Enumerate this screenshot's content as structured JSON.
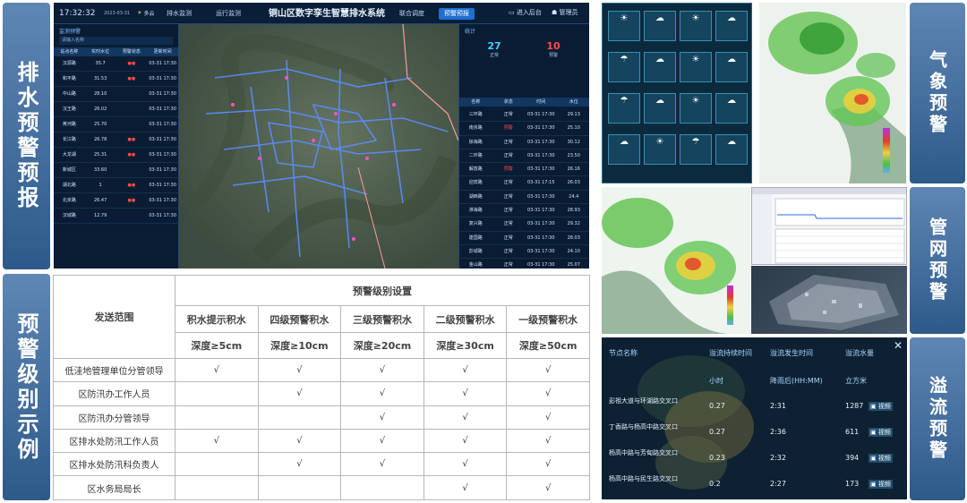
{
  "labels": {
    "drainage_warning": "排水预警预报",
    "level_examples": "预警级别示例",
    "weather_warning": "气象预警",
    "pipe_warning": "管网预警",
    "overflow_warning": "溢流预警"
  },
  "dashboard": {
    "clock": "17:32:32",
    "date": "2023-03-31",
    "weather": "多云",
    "title": "铜山区数字孪生智慧排水系统",
    "tabs": [
      "排水监测",
      "运行监测",
      "联合调度",
      "预警预报"
    ],
    "active_tab": 3,
    "enter_label": "进入后台",
    "user_label": "管理员",
    "left_panel_title": "监测预警",
    "search_placeholder": "请输入名称",
    "left_columns": [
      "站点名称",
      "实时水位",
      "预警状态",
      "更新时间"
    ],
    "left_rows": [
      [
        "汉源路",
        "35.7",
        "●●",
        "03-31 17:30"
      ],
      [
        "和平路",
        "31.53",
        "●●",
        "03-31 17:30"
      ],
      [
        "中山路",
        "28.10",
        "",
        "03-31 17:30"
      ],
      [
        "汉王路",
        "26.02",
        "",
        "03-31 17:30"
      ],
      [
        "黄河路",
        "25.70",
        "",
        "03-31 17:30"
      ],
      [
        "长江路",
        "26.78",
        "●●",
        "03-31 17:30"
      ],
      [
        "大龙湖",
        "25.31",
        "●●",
        "03-31 17:30"
      ],
      [
        "新城区",
        "33.60",
        "",
        "03-31 17:30"
      ],
      [
        "湖北路",
        "1",
        "●●",
        "03-31 17:30"
      ],
      [
        "北京路",
        "26.47",
        "●●",
        "03-31 17:30"
      ],
      [
        "汉城路",
        "12.79",
        "",
        "03-31 17:30"
      ]
    ],
    "right_panel_title": "统计",
    "count_a": "27",
    "count_a_label": "正常",
    "count_b": "10",
    "count_b_label": "预警",
    "right_columns": [
      "名称",
      "状态",
      "时间",
      "水位"
    ],
    "right_rows": [
      [
        "三环路",
        "正常",
        "03-31 17:30",
        "29.13"
      ],
      [
        "南京路",
        "预警",
        "03-31 17:30",
        "25.10"
      ],
      [
        "徐海路",
        "正常",
        "03-31 17:30",
        "30.12"
      ],
      [
        "二环路",
        "正常",
        "03-31 17:30",
        "23.50"
      ],
      [
        "解放路",
        "预警",
        "03-31 17:30",
        "26.16"
      ],
      [
        "迎宾路",
        "正常",
        "03-31 17:15",
        "26.03"
      ],
      [
        "湖西路",
        "正常",
        "03-31 17:30",
        "24.4"
      ],
      [
        "淮海路",
        "正常",
        "03-31 17:30",
        "28.93"
      ],
      [
        "复兴路",
        "正常",
        "03-31 17:30",
        "29.32"
      ],
      [
        "建国路",
        "正常",
        "03-31 17:30",
        "28.03"
      ],
      [
        "彭城路",
        "正常",
        "03-31 17:30",
        "24.10"
      ],
      [
        "金山路",
        "正常",
        "03-31 17:30",
        "25.07"
      ]
    ]
  },
  "table": {
    "scope_header": "发送范围",
    "levels_header": "预警级别设置",
    "levels": [
      "积水提示积水",
      "四级预警积水",
      "三级预警积水",
      "二级预警积水",
      "一级预警积水"
    ],
    "depths": [
      "深度≥5cm",
      "深度≥10cm",
      "深度≥20cm",
      "深度≥30cm",
      "深度≥50cm"
    ],
    "check": "√",
    "rows": [
      {
        "name": "低洼地管理单位分管领导",
        "checks": [
          1,
          1,
          1,
          1,
          1
        ]
      },
      {
        "name": "区防汛办工作人员",
        "checks": [
          0,
          1,
          1,
          1,
          1
        ]
      },
      {
        "name": "区防汛办分管领导",
        "checks": [
          0,
          0,
          1,
          1,
          1
        ]
      },
      {
        "name": "区排水处防汛工作人员",
        "checks": [
          1,
          1,
          1,
          1,
          1
        ]
      },
      {
        "name": "区排水处防汛科负责人",
        "checks": [
          0,
          1,
          1,
          1,
          1
        ]
      },
      {
        "name": "区水务局局长",
        "checks": [
          0,
          0,
          0,
          1,
          1
        ]
      }
    ]
  },
  "overflow": {
    "headers": [
      "节点名称",
      "溢流持续时间",
      "溢流发生时间",
      "溢流水量"
    ],
    "units": [
      "小时",
      "降雨后(HH:MM)",
      "立方米"
    ],
    "video_label": "视频",
    "rows": [
      {
        "name": "彭祖大道与环湖路交叉口",
        "duration": "0.27",
        "time": "2:31",
        "volume": "1287"
      },
      {
        "name": "丁香路与杨高中路交叉口",
        "duration": "0.27",
        "time": "2:36",
        "volume": "611"
      },
      {
        "name": "杨高中路与芳甸路交叉口",
        "duration": "0.23",
        "time": "2:32",
        "volume": "394"
      },
      {
        "name": "杨高中路与民生路交叉口",
        "duration": "0.2",
        "time": "2:27",
        "volume": "173"
      }
    ]
  }
}
